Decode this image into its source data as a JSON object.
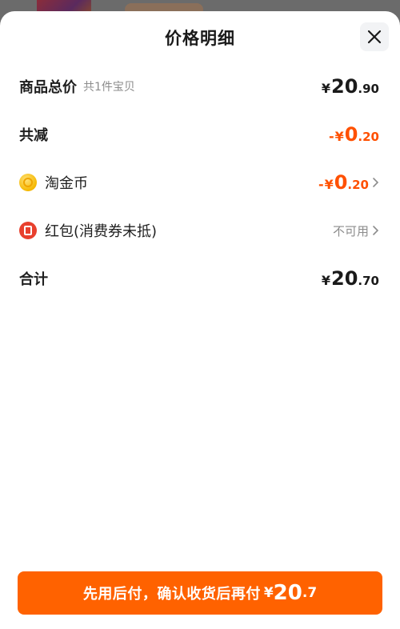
{
  "header": {
    "title": "价格明细"
  },
  "rows": {
    "subtotal": {
      "label": "商品总价",
      "sub": "共1件宝贝",
      "currency": "¥",
      "int": "20",
      "dec": ".90"
    },
    "discount": {
      "label": "共减",
      "sign": "-",
      "currency": "¥",
      "int": "0",
      "dec": ".20"
    },
    "coins": {
      "label": "淘金币",
      "sign": "-",
      "currency": "¥",
      "int": "0",
      "dec": ".20"
    },
    "redpacket": {
      "label": "红包(消费券未抵)",
      "status": "不可用"
    },
    "total": {
      "label": "合计",
      "currency": "¥",
      "int": "20",
      "dec": ".70"
    }
  },
  "pay_button": {
    "text": "先用后付，确认收货后再付",
    "currency": "¥",
    "int": "20",
    "dec": ".7"
  },
  "colors": {
    "accent": "#ff6200",
    "discount": "#ff5000"
  },
  "icons": {
    "close": "close-icon",
    "coin": "coin-icon",
    "redpacket": "red-packet-icon",
    "chevron": "chevron-right-icon"
  }
}
